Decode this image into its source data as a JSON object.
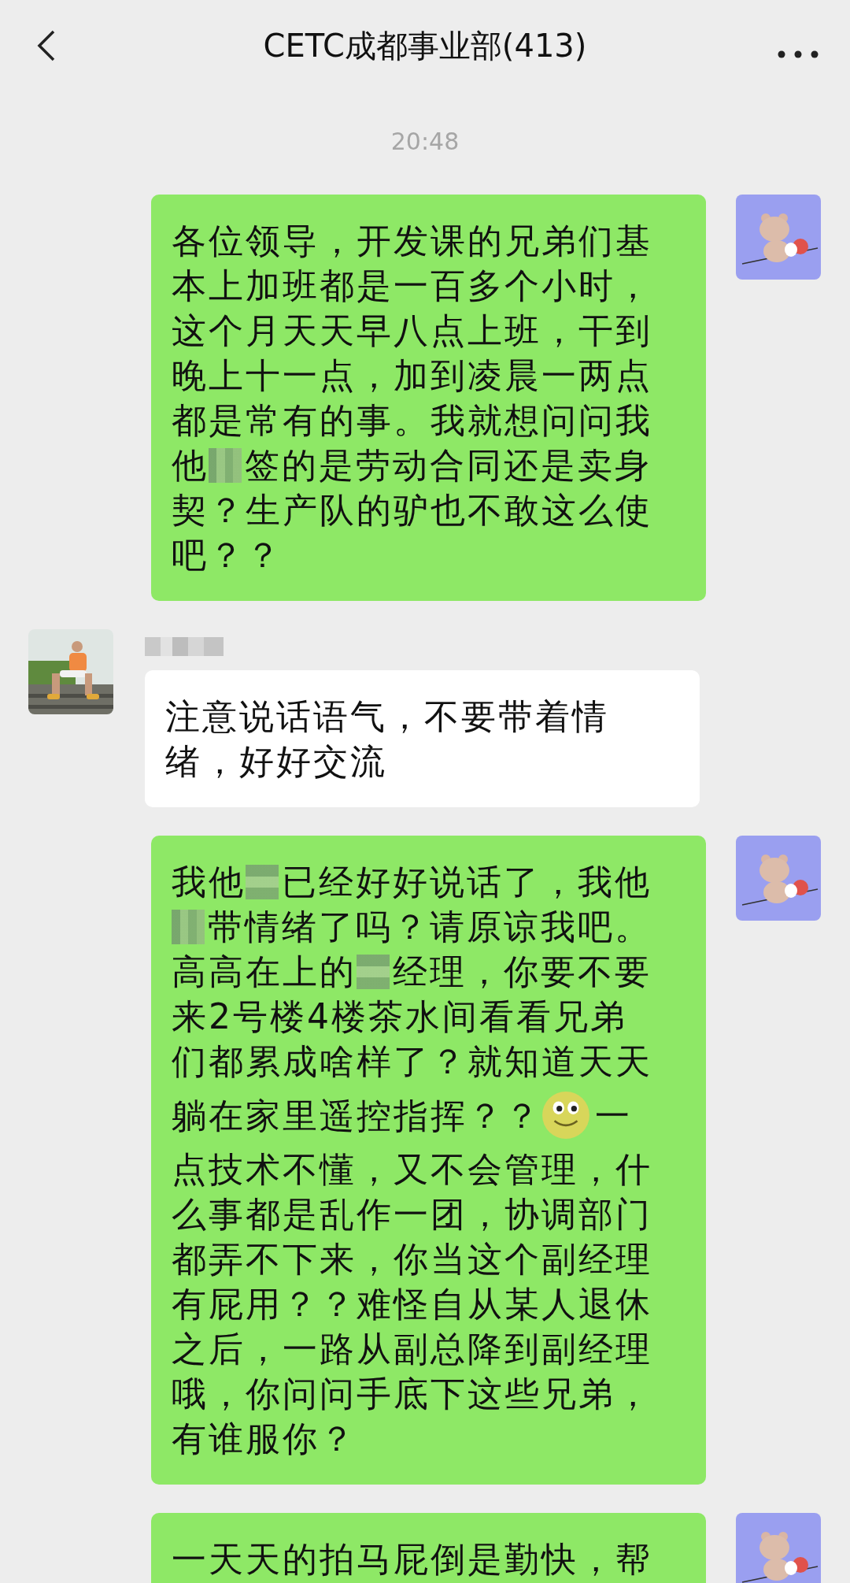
{
  "header": {
    "title": "CETC成都事业部(413)"
  },
  "timestamp": "20:48",
  "messages": [
    {
      "kind": "outgoing",
      "lines": [
        [
          "各位领导，开发课的兄弟们基"
        ],
        [
          "本上加班都是一百多个小时，"
        ],
        [
          "这个月天天早八点上班，干到"
        ],
        [
          "晚上十一点，加到凌晨一两点"
        ],
        [
          "都是常有的事。我就想问问我"
        ],
        [
          "他",
          {
            "kind": "censored"
          },
          "签的是劳动合同还是卖身"
        ],
        [
          "契？生产队的驴也不敢这么使"
        ],
        [
          "吧？？"
        ]
      ]
    },
    {
      "kind": "incoming",
      "name_hidden": true,
      "lines": [
        [
          "注意说话语气，不要带着情"
        ],
        [
          "绪，好好交流"
        ]
      ]
    },
    {
      "kind": "outgoing",
      "lines": [
        [
          "我他",
          {
            "kind": "censored"
          },
          "已经好好说话了，我他"
        ],
        [
          {
            "kind": "censored"
          },
          "带情绪了吗？请原谅我吧。"
        ],
        [
          "高高在上的",
          {
            "kind": "censored"
          },
          "经理，你要不要"
        ],
        [
          "来2号楼4楼茶水间看看兄弟"
        ],
        [
          "们都累成啥样了？就知道天天"
        ],
        [
          "躺在家里遥控指挥？？",
          {
            "kind": "emoji"
          },
          "一"
        ],
        [
          "点技术不懂，又不会管理，什"
        ],
        [
          "么事都是乱作一团，协调部门"
        ],
        [
          "都弄不下来，你当这个副经理"
        ],
        [
          "有屁用？？难怪自从某人退休"
        ],
        [
          "之后，一路从副总降到副经理"
        ],
        [
          "哦，你问问手底下这些兄弟，"
        ],
        [
          "有谁服你？"
        ]
      ]
    },
    {
      "kind": "outgoing",
      "lines": [
        [
          "一天天的拍马屁倒是勤快，帮"
        ]
      ]
    }
  ]
}
